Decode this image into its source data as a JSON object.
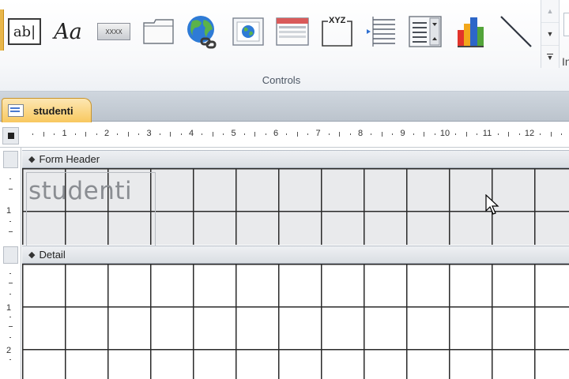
{
  "ribbon": {
    "group_label": "Controls",
    "controls": [
      {
        "name": "text-box-icon",
        "label": "ab|"
      },
      {
        "name": "label-icon",
        "label": "Aa"
      },
      {
        "name": "button-icon",
        "label": "XXXX"
      },
      {
        "name": "tab-control-icon"
      },
      {
        "name": "hyperlink-icon"
      },
      {
        "name": "web-browser-icon"
      },
      {
        "name": "navigation-control-icon"
      },
      {
        "name": "option-group-icon",
        "label": "XYZ"
      },
      {
        "name": "page-break-icon"
      },
      {
        "name": "combo-box-icon"
      },
      {
        "name": "chart-icon"
      },
      {
        "name": "line-icon"
      }
    ],
    "scroll_up": "▲",
    "scroll_down": "▼",
    "more": "▼",
    "cut_text": "In"
  },
  "document_tab": {
    "label": "studenti"
  },
  "ruler": {
    "numbers": [
      "1",
      "2",
      "3",
      "4",
      "5",
      "6",
      "7",
      "8",
      "9",
      "10",
      "11",
      "12"
    ]
  },
  "vruler": {
    "header_number": "1",
    "detail_numbers": [
      "1",
      "2"
    ]
  },
  "sections": {
    "form_header": {
      "label": "Form Header",
      "title_text": "studenti"
    },
    "detail": {
      "label": "Detail"
    }
  }
}
